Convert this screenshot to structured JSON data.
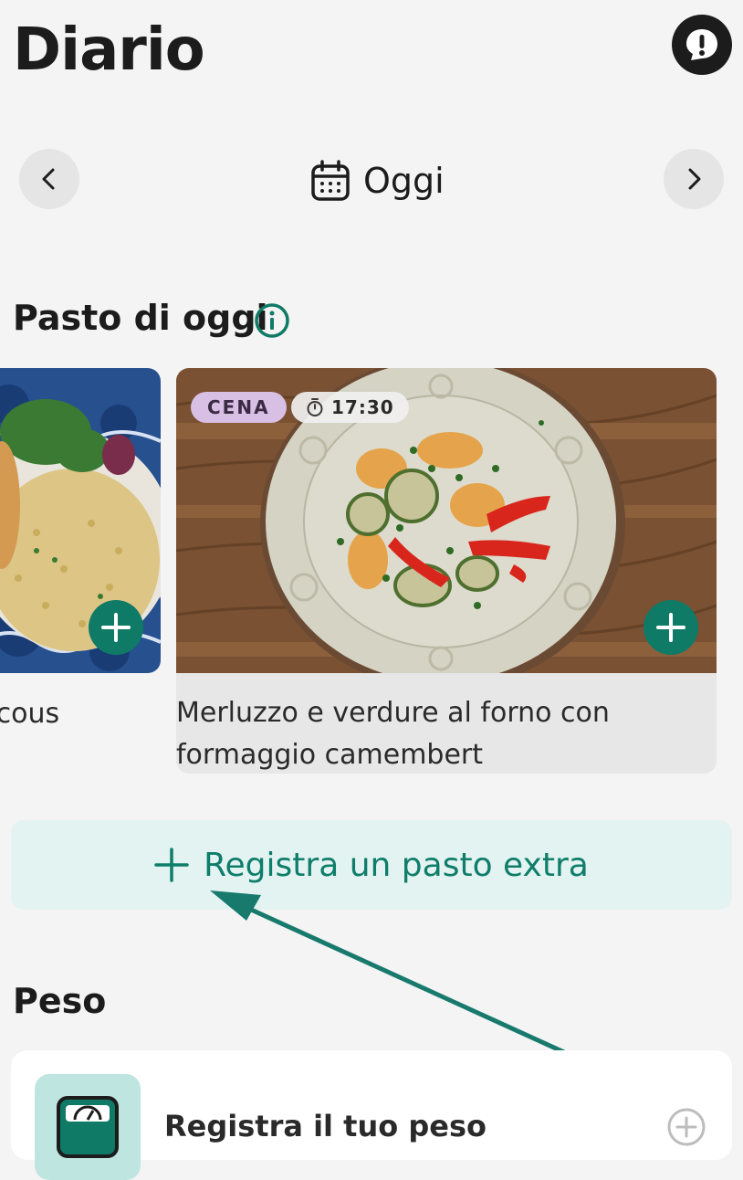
{
  "header": {
    "title": "Diario",
    "feedback_icon": "exclamation-speech-icon"
  },
  "date_nav": {
    "label": "Oggi",
    "prev_icon": "chevron-left-icon",
    "next_icon": "chevron-right-icon",
    "calendar_icon": "calendar-icon"
  },
  "meals_section": {
    "title": "Pasto di oggi",
    "info_icon": "info-icon",
    "cards": [
      {
        "title_partial": "scous"
      },
      {
        "badge": "CENA",
        "time": "17:30",
        "title_line1": "Merluzzo e verdure al forno con",
        "title_line2": "formaggio camembert"
      }
    ]
  },
  "extra_meal": {
    "label": "Registra un pasto extra"
  },
  "weight_section": {
    "title": "Peso",
    "card_label": "Registra il tuo peso"
  },
  "colors": {
    "accent": "#0f7a66",
    "accent_light_bg": "#e3f3f1",
    "badge_bg": "#d8bfe4",
    "background": "#f4f4f4"
  }
}
